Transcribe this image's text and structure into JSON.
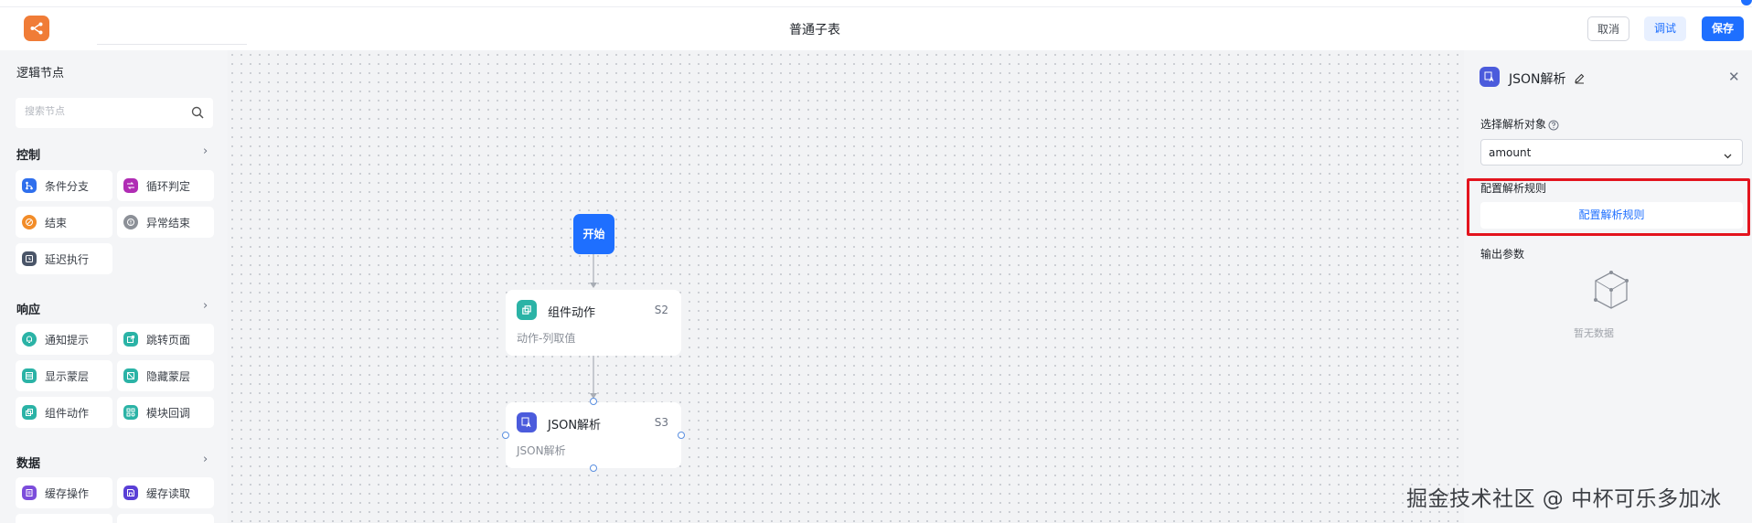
{
  "header": {
    "title": "普通子表",
    "cancel_label": "取消",
    "debug_label": "调试",
    "save_label": "保存"
  },
  "left_panel": {
    "title": "逻辑节点",
    "search_placeholder": "搜索节点",
    "sections": [
      {
        "title": "控制",
        "arrow": "›",
        "items": [
          {
            "label": "条件分支",
            "icon": "branch-icon",
            "color": "#2f6fed"
          },
          {
            "label": "循环判定",
            "icon": "loop-icon",
            "color": "#b02cb4"
          },
          {
            "label": "结束",
            "icon": "end-icon",
            "color": "#f28c28"
          },
          {
            "label": "异常结束",
            "icon": "error-end-icon",
            "color": "#8c9097"
          },
          {
            "label": "延迟执行",
            "icon": "delay-icon",
            "color": "#4a5568"
          }
        ]
      },
      {
        "title": "响应",
        "arrow": "›",
        "items": [
          {
            "label": "通知提示",
            "icon": "bell-icon",
            "color": "#2bb3a6"
          },
          {
            "label": "跳转页面",
            "icon": "redirect-icon",
            "color": "#2bb3a6"
          },
          {
            "label": "显示蒙层",
            "icon": "show-mask-icon",
            "color": "#2bb3a6"
          },
          {
            "label": "隐藏蒙层",
            "icon": "hide-mask-icon",
            "color": "#2bb3a6"
          },
          {
            "label": "组件动作",
            "icon": "component-action-icon",
            "color": "#2bb3a6"
          },
          {
            "label": "模块回调",
            "icon": "module-callback-icon",
            "color": "#2bb3a6"
          }
        ]
      },
      {
        "title": "数据",
        "arrow": "›",
        "items": [
          {
            "label": "缓存操作",
            "icon": "cache-op-icon",
            "color": "#7c4ddb"
          },
          {
            "label": "缓存读取",
            "icon": "cache-read-icon",
            "color": "#5a3fd6"
          }
        ]
      }
    ]
  },
  "canvas": {
    "start_label": "开始",
    "nodes": [
      {
        "title": "组件动作",
        "step": "S2",
        "desc": "动作-列取值",
        "icon": "component-action-icon",
        "color": "#2bb3a6"
      },
      {
        "title": "JSON解析",
        "step": "S3",
        "desc": "JSON解析",
        "icon": "json-parse-icon",
        "color": "#4b5bdc"
      }
    ]
  },
  "right_panel": {
    "title": "JSON解析",
    "select_target_label": "选择解析对象",
    "select_value": "amount",
    "config_rules_label": "配置解析规则",
    "config_rules_button": "配置解析规则",
    "output_params_label": "输出参数",
    "empty_text": "暂无数据"
  },
  "watermark": "掘金技术社区 @ 中杯可乐多加冰",
  "colors": {
    "primary": "#1e6fff",
    "highlight_border": "#e3141e",
    "logo": "#f07c37"
  }
}
